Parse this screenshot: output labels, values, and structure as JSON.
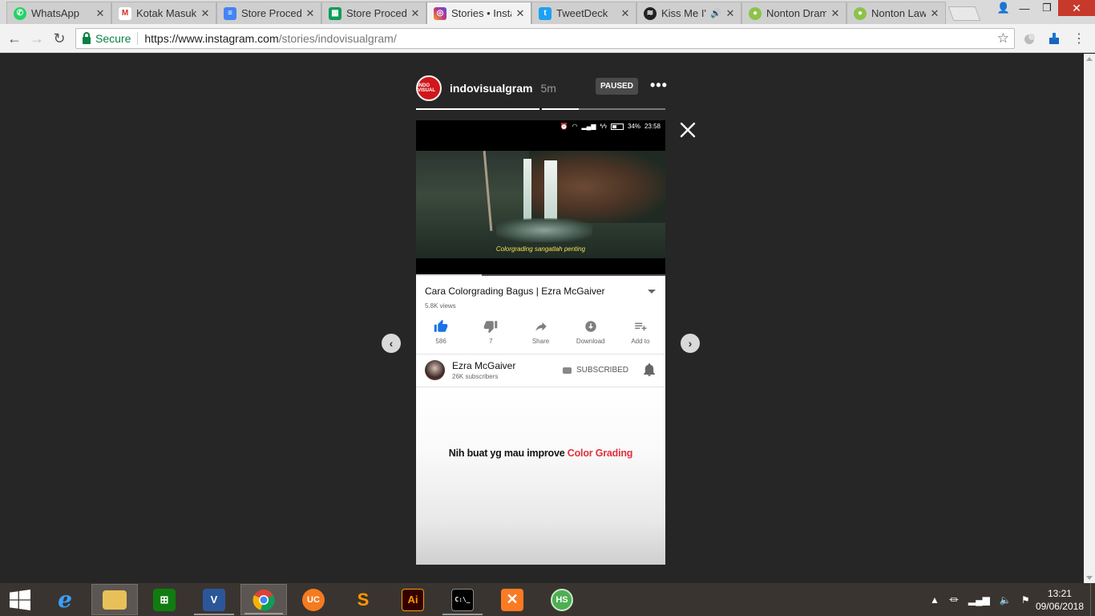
{
  "browser": {
    "tabs": [
      {
        "label": "WhatsApp",
        "icon": "whatsapp-icon",
        "color": "#25d366",
        "active": false
      },
      {
        "label": "Kotak Masuk",
        "icon": "gmail-icon",
        "color": "#d93025",
        "active": false
      },
      {
        "label": "Store Proced",
        "icon": "google-docs-icon",
        "color": "#4285f4",
        "active": false
      },
      {
        "label": "Store Proced",
        "icon": "google-sheets-icon",
        "color": "#0f9d58",
        "active": false
      },
      {
        "label": "Stories • Insta",
        "icon": "instagram-icon",
        "color": "#c13584",
        "active": true
      },
      {
        "label": "TweetDeck",
        "icon": "tweetdeck-icon",
        "color": "#1da1f2",
        "active": false
      },
      {
        "label": "Kiss Me I'",
        "icon": "spotify-icon",
        "color": "#222222",
        "active": false
      },
      {
        "label": "Nonton Dram",
        "icon": "site-icon",
        "color": "#8bc34a",
        "active": false
      },
      {
        "label": "Nonton Lawle",
        "icon": "site-icon",
        "color": "#8bc34a",
        "active": false
      }
    ],
    "secure_label": "Secure",
    "url_host": "https://www.instagram.com",
    "url_path": "/stories/indovisualgram/"
  },
  "story": {
    "username": "indovisualgram",
    "age": "5m",
    "paused_label": "PAUSED",
    "more_label": "•••",
    "avatar_text": "INDO VISUAL",
    "progress_segments": [
      1.0,
      0.3
    ],
    "phone_status": {
      "battery": "34%",
      "time": "23:58"
    },
    "video_caption": "Colorgrading sangatlah penting",
    "video_title": "Cara Colorgrading Bagus | Ezra McGaiver",
    "views": "5.8K views",
    "actions": [
      {
        "icon": "thumbs-up-icon",
        "glyph": "👍",
        "label": "586"
      },
      {
        "icon": "thumbs-down-icon",
        "glyph": "👎",
        "label": "7"
      },
      {
        "icon": "share-icon",
        "glyph": "➦",
        "label": "Share"
      },
      {
        "icon": "download-icon",
        "glyph": "⬇",
        "label": "Download"
      },
      {
        "icon": "add-to-playlist-icon",
        "glyph": "≡+",
        "label": "Add to"
      }
    ],
    "channel_name": "Ezra McGaiver",
    "subscribers": "26K subscribers",
    "subscribed_label": "SUBSCRIBED",
    "promo_text": "Nih buat yg mau improve",
    "promo_highlight": "Color Grading",
    "highlight_color": "#e0303c"
  },
  "taskbar": {
    "apps": [
      {
        "name": "internet-explorer",
        "glyph": "e",
        "color": "#1e90ff"
      },
      {
        "name": "file-explorer",
        "glyph": "▤",
        "color": "#e8b73a"
      },
      {
        "name": "windows-store",
        "glyph": "⊞",
        "color": "#107c10"
      },
      {
        "name": "visual-studio",
        "glyph": "V",
        "color": "#2b579a"
      },
      {
        "name": "google-chrome",
        "glyph": "",
        "color": "#db4437"
      },
      {
        "name": "uc-browser",
        "glyph": "UC",
        "color": "#f47b20"
      },
      {
        "name": "sublime-text",
        "glyph": "S",
        "color": "#ff9800"
      },
      {
        "name": "adobe-illustrator",
        "glyph": "Ai",
        "color": "#330000"
      },
      {
        "name": "command-prompt",
        "glyph": "C:\\_",
        "color": "#000000"
      },
      {
        "name": "xampp",
        "glyph": "✕",
        "color": "#fb7a24"
      },
      {
        "name": "hs-app",
        "glyph": "HS",
        "color": "#4caf50"
      }
    ],
    "time": "13:21",
    "date": "09/06/2018"
  }
}
